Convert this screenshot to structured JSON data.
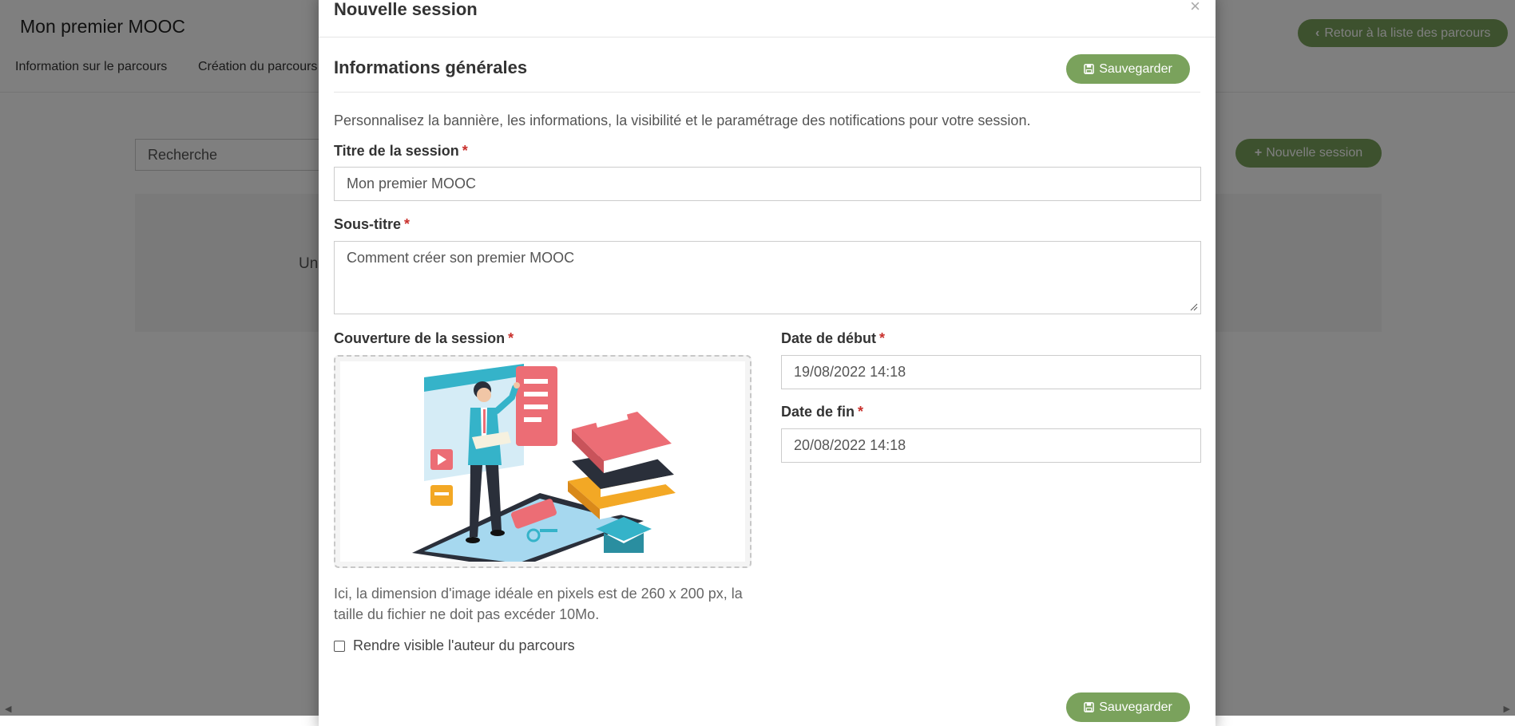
{
  "background": {
    "course_title": "Mon premier MOOC",
    "tabs": [
      {
        "label": "Information sur le parcours"
      },
      {
        "label": "Création du parcours"
      }
    ],
    "back_button_label": "Retour à la liste des parcours",
    "search_placeholder": "Recherche",
    "new_session_button_label": "Nouvelle session",
    "panel_text": "Un"
  },
  "modal": {
    "title": "Nouvelle session",
    "close_symbol": "×",
    "section_title": "Informations générales",
    "save_label": "Sauvegarder",
    "description": "Personnalisez la bannière, les informations, la visibilité et le paramétrage des notifications pour votre session.",
    "required_marker": "*",
    "fields": {
      "title": {
        "label": "Titre de la session",
        "value": "Mon premier MOOC"
      },
      "subtitle": {
        "label": "Sous-titre",
        "value": "Comment créer son premier MOOC"
      },
      "cover": {
        "label": "Couverture de la session"
      },
      "start_date": {
        "label": "Date de début",
        "value": "19/08/2022 14:18"
      },
      "end_date": {
        "label": "Date de fin",
        "value": "20/08/2022 14:18"
      }
    },
    "image_hint": "Ici, la dimension d'image idéale en pixels est de 260 x 200 px, la taille du fichier ne doit pas excéder 10Mo.",
    "checkbox": {
      "label": "Rendre visible l'auteur du parcours",
      "checked": false
    }
  },
  "colors": {
    "accent": "#7aa25c",
    "required": "#c9302c",
    "overlay": "rgba(0,0,0,0.5)"
  }
}
